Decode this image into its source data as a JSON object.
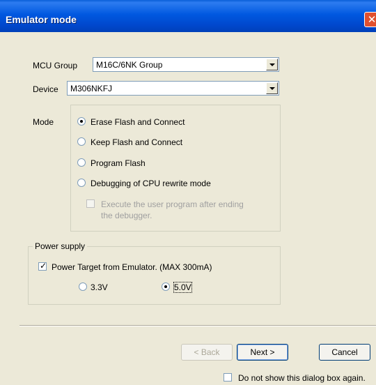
{
  "window": {
    "title": "Emulator mode",
    "close_glyph": "✕"
  },
  "mcu_group": {
    "label": "MCU Group",
    "value": "M16C/6NK Group"
  },
  "device": {
    "label": "Device",
    "value": "M306NKFJ"
  },
  "mode": {
    "label": "Mode",
    "options": [
      {
        "label": "Erase Flash and Connect",
        "selected": true
      },
      {
        "label": "Keep Flash and Connect",
        "selected": false
      },
      {
        "label": "Program Flash",
        "selected": false
      },
      {
        "label": "Debugging of CPU rewrite mode",
        "selected": false
      }
    ],
    "execute_option": {
      "line1": "Execute the user program after ending",
      "line2": "the debugger.",
      "checked": false,
      "enabled": false
    }
  },
  "power_supply": {
    "label": "Power supply",
    "power_target": {
      "label": "Power Target from Emulator. (MAX 300mA)",
      "checked": true
    },
    "voltage_options": [
      {
        "label": "3.3V",
        "selected": false
      },
      {
        "label": "5.0V",
        "selected": true
      }
    ]
  },
  "buttons": {
    "back": "< Back",
    "next": "Next >",
    "cancel": "Cancel"
  },
  "footer": {
    "dont_show_label": "Do not show this dialog box again.",
    "checked": false
  },
  "colors": {
    "title_bar": "#0058E0",
    "dialog_bg": "#ECE9D8",
    "close_button": "#E0502E"
  }
}
